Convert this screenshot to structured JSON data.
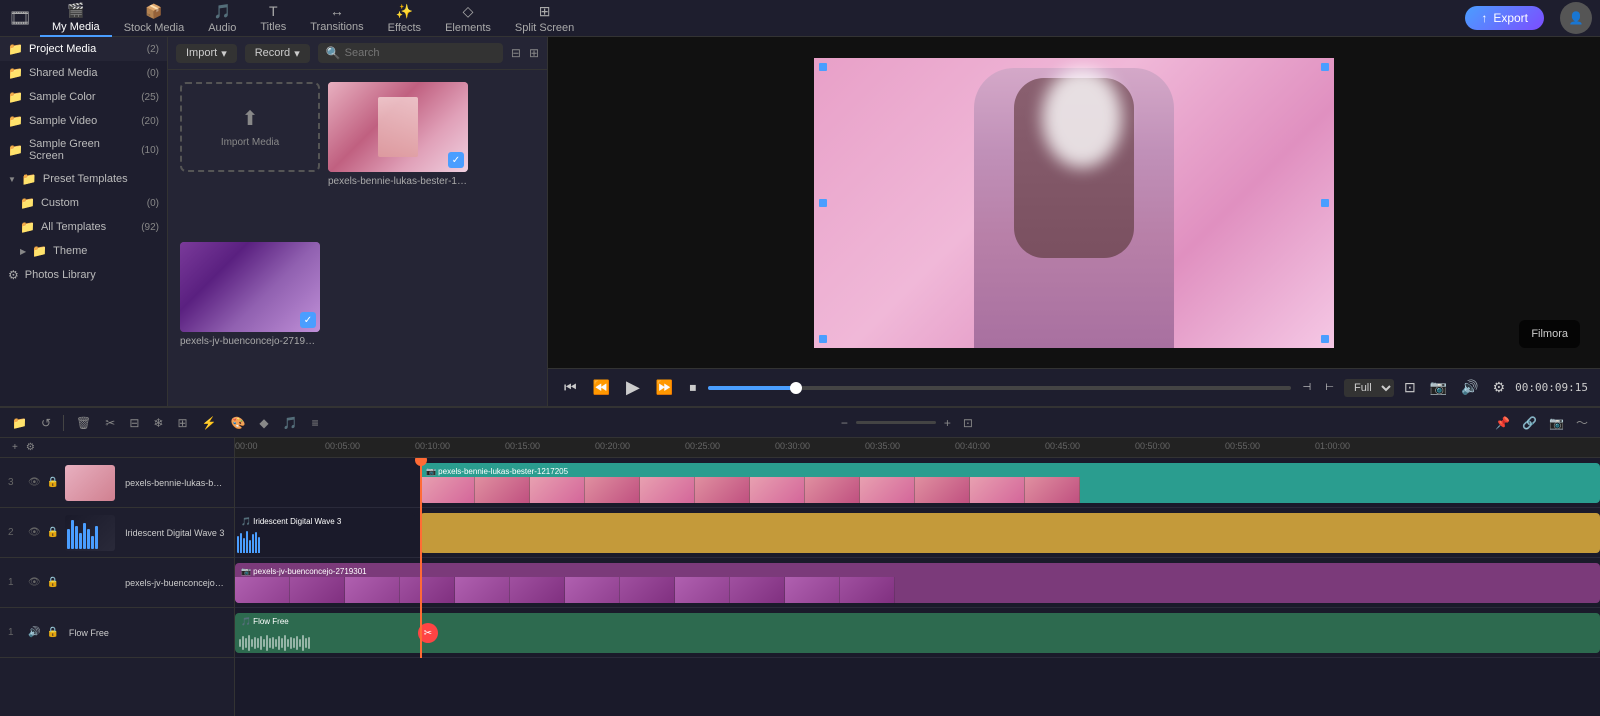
{
  "nav": {
    "items": [
      {
        "id": "my-media",
        "label": "My Media",
        "icon": "🎬",
        "active": true
      },
      {
        "id": "stock-media",
        "label": "Stock Media",
        "icon": "📦",
        "active": false
      },
      {
        "id": "audio",
        "label": "Audio",
        "icon": "🎵",
        "active": false
      },
      {
        "id": "titles",
        "label": "Titles",
        "icon": "T",
        "active": false
      },
      {
        "id": "transitions",
        "label": "Transitions",
        "icon": "↔",
        "active": false
      },
      {
        "id": "effects",
        "label": "Effects",
        "icon": "✨",
        "active": false
      },
      {
        "id": "elements",
        "label": "Elements",
        "icon": "◇",
        "active": false
      },
      {
        "id": "split-screen",
        "label": "Split Screen",
        "icon": "⊞",
        "active": false
      }
    ],
    "export_label": "Export"
  },
  "sidebar": {
    "items": [
      {
        "id": "project-media",
        "label": "Project Media",
        "count": 2,
        "level": 0,
        "active": true
      },
      {
        "id": "shared-media",
        "label": "Shared Media",
        "count": 0,
        "level": 0
      },
      {
        "id": "sample-color",
        "label": "Sample Color",
        "count": 25,
        "level": 0
      },
      {
        "id": "sample-video",
        "label": "Sample Video",
        "count": 20,
        "level": 0
      },
      {
        "id": "sample-green",
        "label": "Sample Green Screen",
        "count": 10,
        "level": 0
      },
      {
        "id": "preset-templates",
        "label": "Preset Templates",
        "count": null,
        "level": 0,
        "expandable": true,
        "expanded": true
      },
      {
        "id": "custom",
        "label": "Custom",
        "count": 0,
        "level": 1
      },
      {
        "id": "all-templates",
        "label": "All Templates",
        "count": 92,
        "level": 1
      },
      {
        "id": "theme",
        "label": "Theme",
        "count": null,
        "level": 1
      },
      {
        "id": "photos-library",
        "label": "Photos Library",
        "count": null,
        "level": 0
      }
    ]
  },
  "media_panel": {
    "import_label": "Import",
    "record_label": "Record",
    "search_placeholder": "Search",
    "filter_icon": "⊟",
    "grid_icon": "⊞",
    "import_media_label": "Import Media",
    "cards": [
      {
        "id": "card1",
        "filename": "pexels-bennie-lukas-bester-1217205",
        "has_check": true,
        "type": "video_pink"
      },
      {
        "id": "card2",
        "filename": "pexels-jv-buenconcejo-2719301",
        "has_check": true,
        "type": "video_purple"
      }
    ]
  },
  "preview": {
    "time_display": "00:00:09:15",
    "quality_label": "Full",
    "progress_percent": 15
  },
  "timeline": {
    "ruler_times": [
      "00:00",
      "00:05:00",
      "00:10:00",
      "00:15:00",
      "00:20:00",
      "00:25:00",
      "00:30:00",
      "00:35:00",
      "00:40:00",
      "00:45:00",
      "00:50:00",
      "00:55:00",
      "01:00:00"
    ],
    "tracks": [
      {
        "num": 3,
        "icon": "🎬",
        "name": "pexels-bennie-lukas-bester-1217205",
        "color": "teal",
        "type": "video"
      },
      {
        "num": 2,
        "icon": "🎵",
        "name": "Iridescent Digital Wave 3",
        "color": "gold",
        "type": "audio_video"
      },
      {
        "num": 1,
        "icon": "🎬",
        "name": "pexels-jv-buenconcejo-2719301",
        "color": "pink",
        "type": "video"
      },
      {
        "num": 1,
        "icon": "🎵",
        "name": "Flow Free",
        "color": "green",
        "type": "audio"
      }
    ],
    "playhead_time": "00:10:00"
  }
}
